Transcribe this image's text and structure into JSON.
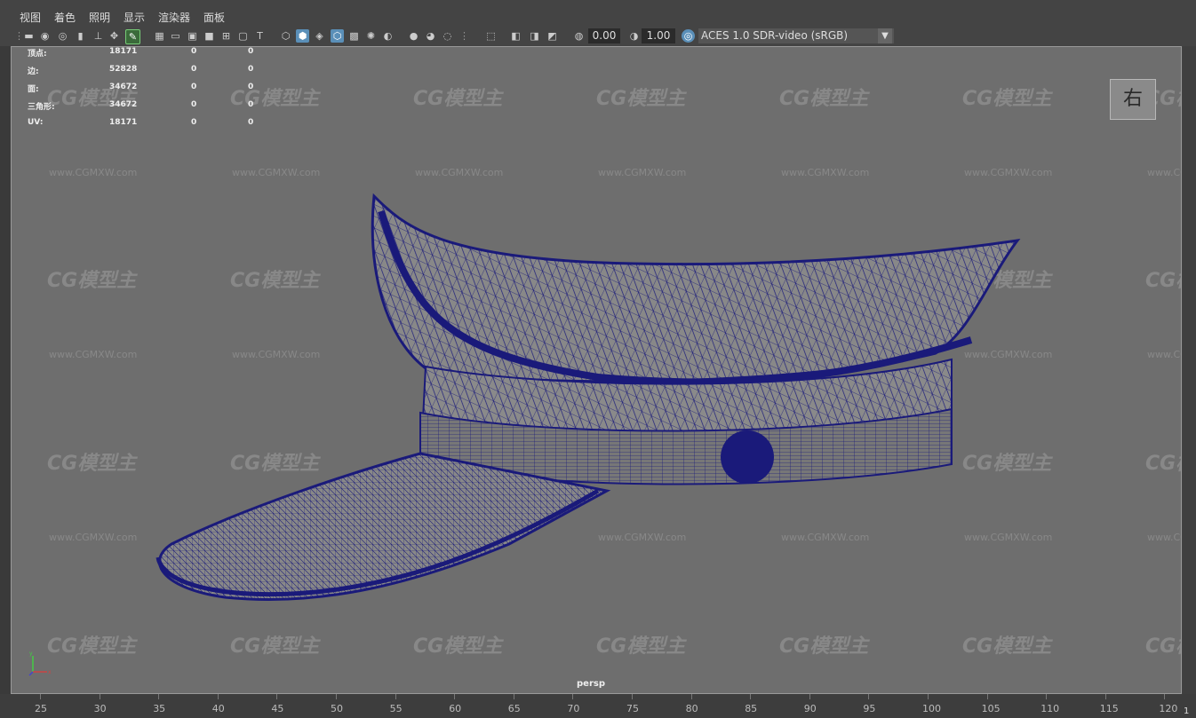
{
  "menu": [
    "视图",
    "着色",
    "照明",
    "显示",
    "渲染器",
    "面板"
  ],
  "toolbar": {
    "exposure_value": "0.00",
    "gamma_value": "1.00",
    "color_space": "ACES 1.0 SDR-video (sRGB)"
  },
  "hud": {
    "rows": [
      {
        "label": "顶点:",
        "v1": "18171",
        "v2": "0",
        "v3": "0"
      },
      {
        "label": "边:",
        "v1": "52828",
        "v2": "0",
        "v3": "0"
      },
      {
        "label": "面:",
        "v1": "34672",
        "v2": "0",
        "v3": "0"
      },
      {
        "label": "三角形:",
        "v1": "34672",
        "v2": "0",
        "v3": "0"
      },
      {
        "label": "UV:",
        "v1": "18171",
        "v2": "0",
        "v3": "0"
      }
    ]
  },
  "view_cube_label": "右",
  "camera_label": "persp",
  "watermark": {
    "logo": "CG模型主",
    "url": "www.CGMXW.com"
  },
  "timeline": {
    "ticks": [
      "25",
      "30",
      "35",
      "40",
      "45",
      "50",
      "55",
      "60",
      "65",
      "70",
      "75",
      "80",
      "85",
      "90",
      "95",
      "100",
      "105",
      "110",
      "115",
      "120"
    ],
    "current_frame": "1"
  },
  "colors": {
    "wireframe": "#1a1a7a",
    "viewport_bg": "#6e6e6e",
    "active_icon": "#5a8fb8"
  }
}
